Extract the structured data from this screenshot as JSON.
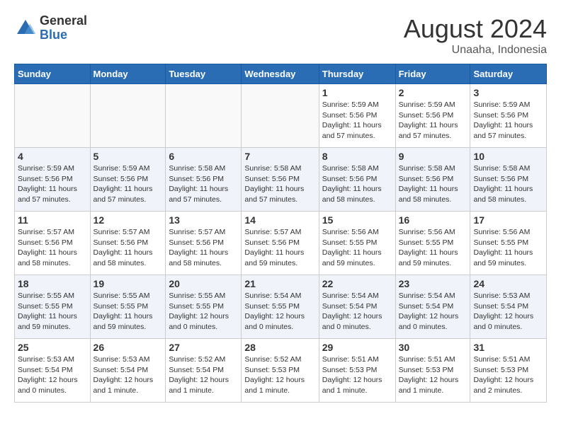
{
  "logo": {
    "general": "General",
    "blue": "Blue"
  },
  "title": {
    "month_year": "August 2024",
    "location": "Unaaha, Indonesia"
  },
  "header_days": [
    "Sunday",
    "Monday",
    "Tuesday",
    "Wednesday",
    "Thursday",
    "Friday",
    "Saturday"
  ],
  "weeks": [
    [
      {
        "day": "",
        "info": ""
      },
      {
        "day": "",
        "info": ""
      },
      {
        "day": "",
        "info": ""
      },
      {
        "day": "",
        "info": ""
      },
      {
        "day": "1",
        "info": "Sunrise: 5:59 AM\nSunset: 5:56 PM\nDaylight: 11 hours\nand 57 minutes."
      },
      {
        "day": "2",
        "info": "Sunrise: 5:59 AM\nSunset: 5:56 PM\nDaylight: 11 hours\nand 57 minutes."
      },
      {
        "day": "3",
        "info": "Sunrise: 5:59 AM\nSunset: 5:56 PM\nDaylight: 11 hours\nand 57 minutes."
      }
    ],
    [
      {
        "day": "4",
        "info": "Sunrise: 5:59 AM\nSunset: 5:56 PM\nDaylight: 11 hours\nand 57 minutes."
      },
      {
        "day": "5",
        "info": "Sunrise: 5:59 AM\nSunset: 5:56 PM\nDaylight: 11 hours\nand 57 minutes."
      },
      {
        "day": "6",
        "info": "Sunrise: 5:58 AM\nSunset: 5:56 PM\nDaylight: 11 hours\nand 57 minutes."
      },
      {
        "day": "7",
        "info": "Sunrise: 5:58 AM\nSunset: 5:56 PM\nDaylight: 11 hours\nand 57 minutes."
      },
      {
        "day": "8",
        "info": "Sunrise: 5:58 AM\nSunset: 5:56 PM\nDaylight: 11 hours\nand 58 minutes."
      },
      {
        "day": "9",
        "info": "Sunrise: 5:58 AM\nSunset: 5:56 PM\nDaylight: 11 hours\nand 58 minutes."
      },
      {
        "day": "10",
        "info": "Sunrise: 5:58 AM\nSunset: 5:56 PM\nDaylight: 11 hours\nand 58 minutes."
      }
    ],
    [
      {
        "day": "11",
        "info": "Sunrise: 5:57 AM\nSunset: 5:56 PM\nDaylight: 11 hours\nand 58 minutes."
      },
      {
        "day": "12",
        "info": "Sunrise: 5:57 AM\nSunset: 5:56 PM\nDaylight: 11 hours\nand 58 minutes."
      },
      {
        "day": "13",
        "info": "Sunrise: 5:57 AM\nSunset: 5:56 PM\nDaylight: 11 hours\nand 58 minutes."
      },
      {
        "day": "14",
        "info": "Sunrise: 5:57 AM\nSunset: 5:56 PM\nDaylight: 11 hours\nand 59 minutes."
      },
      {
        "day": "15",
        "info": "Sunrise: 5:56 AM\nSunset: 5:55 PM\nDaylight: 11 hours\nand 59 minutes."
      },
      {
        "day": "16",
        "info": "Sunrise: 5:56 AM\nSunset: 5:55 PM\nDaylight: 11 hours\nand 59 minutes."
      },
      {
        "day": "17",
        "info": "Sunrise: 5:56 AM\nSunset: 5:55 PM\nDaylight: 11 hours\nand 59 minutes."
      }
    ],
    [
      {
        "day": "18",
        "info": "Sunrise: 5:55 AM\nSunset: 5:55 PM\nDaylight: 11 hours\nand 59 minutes."
      },
      {
        "day": "19",
        "info": "Sunrise: 5:55 AM\nSunset: 5:55 PM\nDaylight: 11 hours\nand 59 minutes."
      },
      {
        "day": "20",
        "info": "Sunrise: 5:55 AM\nSunset: 5:55 PM\nDaylight: 12 hours\nand 0 minutes."
      },
      {
        "day": "21",
        "info": "Sunrise: 5:54 AM\nSunset: 5:55 PM\nDaylight: 12 hours\nand 0 minutes."
      },
      {
        "day": "22",
        "info": "Sunrise: 5:54 AM\nSunset: 5:54 PM\nDaylight: 12 hours\nand 0 minutes."
      },
      {
        "day": "23",
        "info": "Sunrise: 5:54 AM\nSunset: 5:54 PM\nDaylight: 12 hours\nand 0 minutes."
      },
      {
        "day": "24",
        "info": "Sunrise: 5:53 AM\nSunset: 5:54 PM\nDaylight: 12 hours\nand 0 minutes."
      }
    ],
    [
      {
        "day": "25",
        "info": "Sunrise: 5:53 AM\nSunset: 5:54 PM\nDaylight: 12 hours\nand 0 minutes."
      },
      {
        "day": "26",
        "info": "Sunrise: 5:53 AM\nSunset: 5:54 PM\nDaylight: 12 hours\nand 1 minute."
      },
      {
        "day": "27",
        "info": "Sunrise: 5:52 AM\nSunset: 5:54 PM\nDaylight: 12 hours\nand 1 minute."
      },
      {
        "day": "28",
        "info": "Sunrise: 5:52 AM\nSunset: 5:53 PM\nDaylight: 12 hours\nand 1 minute."
      },
      {
        "day": "29",
        "info": "Sunrise: 5:51 AM\nSunset: 5:53 PM\nDaylight: 12 hours\nand 1 minute."
      },
      {
        "day": "30",
        "info": "Sunrise: 5:51 AM\nSunset: 5:53 PM\nDaylight: 12 hours\nand 1 minute."
      },
      {
        "day": "31",
        "info": "Sunrise: 5:51 AM\nSunset: 5:53 PM\nDaylight: 12 hours\nand 2 minutes."
      }
    ]
  ]
}
